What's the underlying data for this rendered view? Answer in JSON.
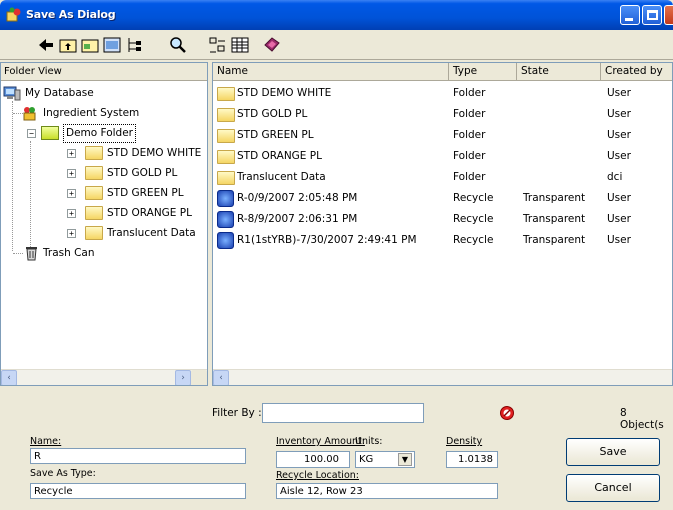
{
  "window": {
    "title": "Save As Dialog"
  },
  "left_pane": {
    "header": "Folder View",
    "tree": [
      {
        "label": "My Database"
      },
      {
        "label": "Ingredient System"
      },
      {
        "label": "Demo Folder"
      },
      {
        "label": "STD DEMO WHITE"
      },
      {
        "label": "STD GOLD PL"
      },
      {
        "label": "STD GREEN PL"
      },
      {
        "label": "STD ORANGE PL"
      },
      {
        "label": "Translucent Data"
      },
      {
        "label": "Trash Can"
      }
    ]
  },
  "list": {
    "columns": [
      "Name",
      "Type",
      "State",
      "Created by"
    ],
    "rows": [
      {
        "name": "STD DEMO WHITE",
        "type": "Folder",
        "state": "",
        "created_by": "User",
        "icon": "folder"
      },
      {
        "name": "STD GOLD PL",
        "type": "Folder",
        "state": "",
        "created_by": "User",
        "icon": "folder"
      },
      {
        "name": "STD GREEN PL",
        "type": "Folder",
        "state": "",
        "created_by": "User",
        "icon": "folder"
      },
      {
        "name": "STD ORANGE PL",
        "type": "Folder",
        "state": "",
        "created_by": "User",
        "icon": "folder"
      },
      {
        "name": "Translucent Data",
        "type": "Folder",
        "state": "",
        "created_by": "dci",
        "icon": "folder"
      },
      {
        "name": "R-0/9/2007 2:05:48 PM",
        "type": "Recycle",
        "state": "Transparent",
        "created_by": "User",
        "icon": "recycle"
      },
      {
        "name": "R-8/9/2007 2:06:31 PM",
        "type": "Recycle",
        "state": "Transparent",
        "created_by": "User",
        "icon": "recycle"
      },
      {
        "name": "R1(1stYRB)-7/30/2007 2:49:41 PM",
        "type": "Recycle",
        "state": "Transparent",
        "created_by": "User",
        "icon": "recycle"
      }
    ]
  },
  "filter": {
    "label": "Filter By :",
    "value": "",
    "count": "8 Object(s"
  },
  "form": {
    "name_label": "Name:",
    "name_value": "R",
    "save_as_type_label": "Save As Type:",
    "save_as_type_value": "Recycle",
    "inventory_label": "Inventory Amount:",
    "inventory_value": "100.00",
    "units_label": "Units:",
    "units_value": "KG",
    "density_label": "Density",
    "density_value": "1.0138",
    "recycle_location_label": "Recycle Location:",
    "recycle_location_value": "Aisle 12, Row 23"
  },
  "buttons": {
    "save": "Save",
    "cancel": "Cancel"
  },
  "colors": {
    "titlebar": "#0053d8",
    "window_bg": "#ece9d8",
    "selection_folder": "#c8df28"
  }
}
